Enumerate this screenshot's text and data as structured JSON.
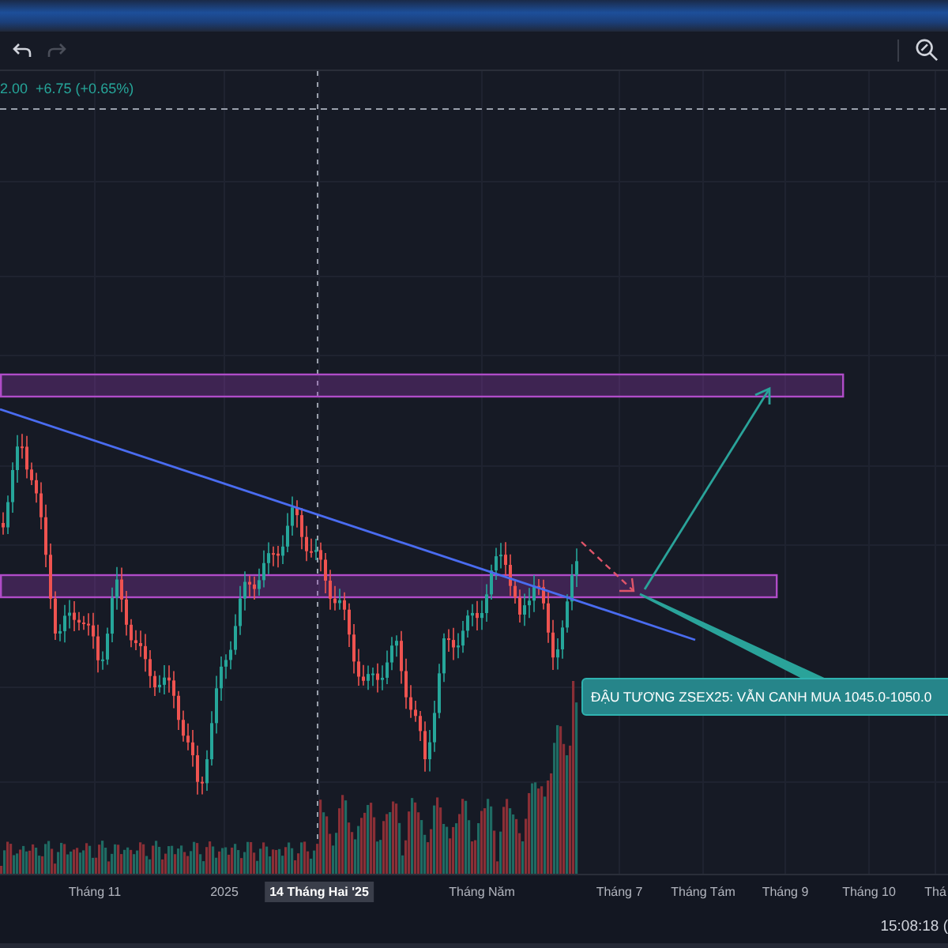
{
  "toolbar": {
    "buttons": [
      {
        "kind": "undo",
        "disabled": false
      },
      {
        "kind": "redo",
        "disabled": true
      }
    ]
  },
  "legend": {
    "price": "2.00",
    "change": "+6.75 (+0.65%)"
  },
  "callout": {
    "text": "ĐẬU TƯƠNG ZSEX25: VẪN CANH MUA 1045.0-1050.0"
  },
  "time_axis": [
    {
      "label": "Tháng 11",
      "selected": false
    },
    {
      "label": "2025",
      "selected": false
    },
    {
      "label": "14 Tháng Hai '25",
      "selected": true
    },
    {
      "label": "Tháng Năm",
      "selected": false
    },
    {
      "label": "Tháng 7",
      "selected": false
    },
    {
      "label": "Tháng Tám",
      "selected": false
    },
    {
      "label": "Tháng 9",
      "selected": false
    },
    {
      "label": "Tháng 10",
      "selected": false
    },
    {
      "label": "Thá",
      "selected": false
    }
  ],
  "status_bar": {
    "time": "15:08:18 ("
  }
}
